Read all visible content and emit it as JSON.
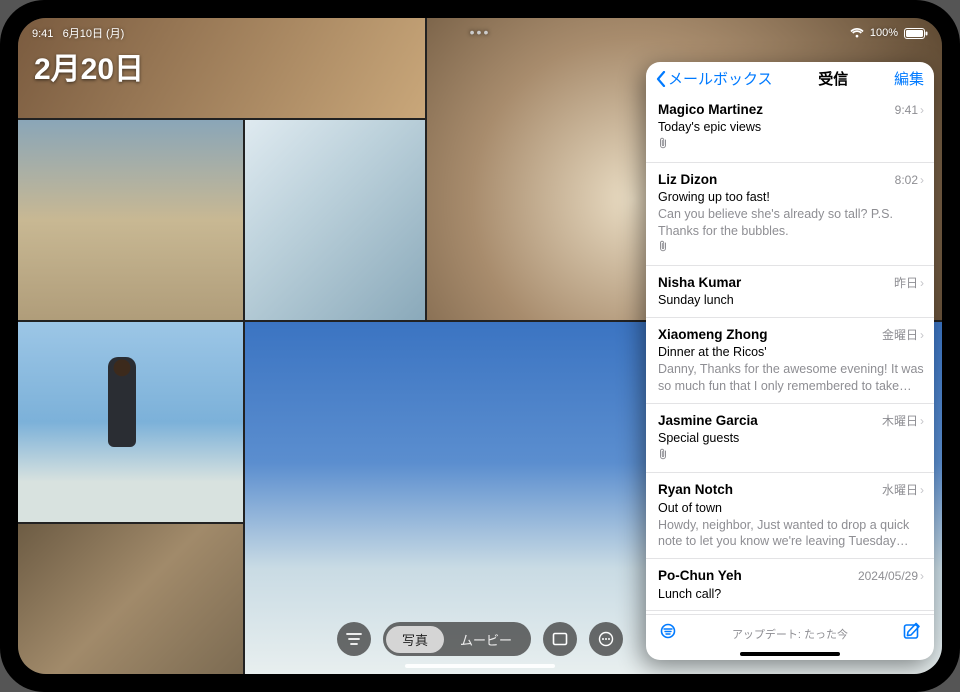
{
  "status": {
    "time": "9:41",
    "date": "6月10日 (月)",
    "battery": "100%"
  },
  "photos": {
    "date_overlay": "2月20日",
    "segmented": {
      "photos": "写真",
      "movies": "ムービー"
    }
  },
  "mail": {
    "handle": "•••",
    "back_label": "メールボックス",
    "title": "受信",
    "edit_label": "編集",
    "updated_label": "アップデート: たった今",
    "items": [
      {
        "sender": "Magico Martinez",
        "time": "9:41",
        "subject": "Today's epic views",
        "preview": "",
        "attachment": true
      },
      {
        "sender": "Liz Dizon",
        "time": "8:02",
        "subject": "Growing up too fast!",
        "preview": "Can you believe she's already so tall? P.S. Thanks for the bubbles.",
        "attachment": true
      },
      {
        "sender": "Nisha Kumar",
        "time": "昨日",
        "subject": "Sunday lunch",
        "preview": "",
        "attachment": false
      },
      {
        "sender": "Xiaomeng Zhong",
        "time": "金曜日",
        "subject": "Dinner at the Ricos'",
        "preview": "Danny, Thanks for the awesome evening! It was so much fun that I only remembered to take on…",
        "attachment": false
      },
      {
        "sender": "Jasmine Garcia",
        "time": "木曜日",
        "subject": "Special guests",
        "preview": "",
        "attachment": true
      },
      {
        "sender": "Ryan Notch",
        "time": "水曜日",
        "subject": "Out of town",
        "preview": "Howdy, neighbor, Just wanted to drop a quick note to let you know we're leaving Tuesday an…",
        "attachment": false
      },
      {
        "sender": "Po-Chun Yeh",
        "time": "2024/05/29",
        "subject": "Lunch call?",
        "preview": "",
        "attachment": false
      }
    ]
  }
}
